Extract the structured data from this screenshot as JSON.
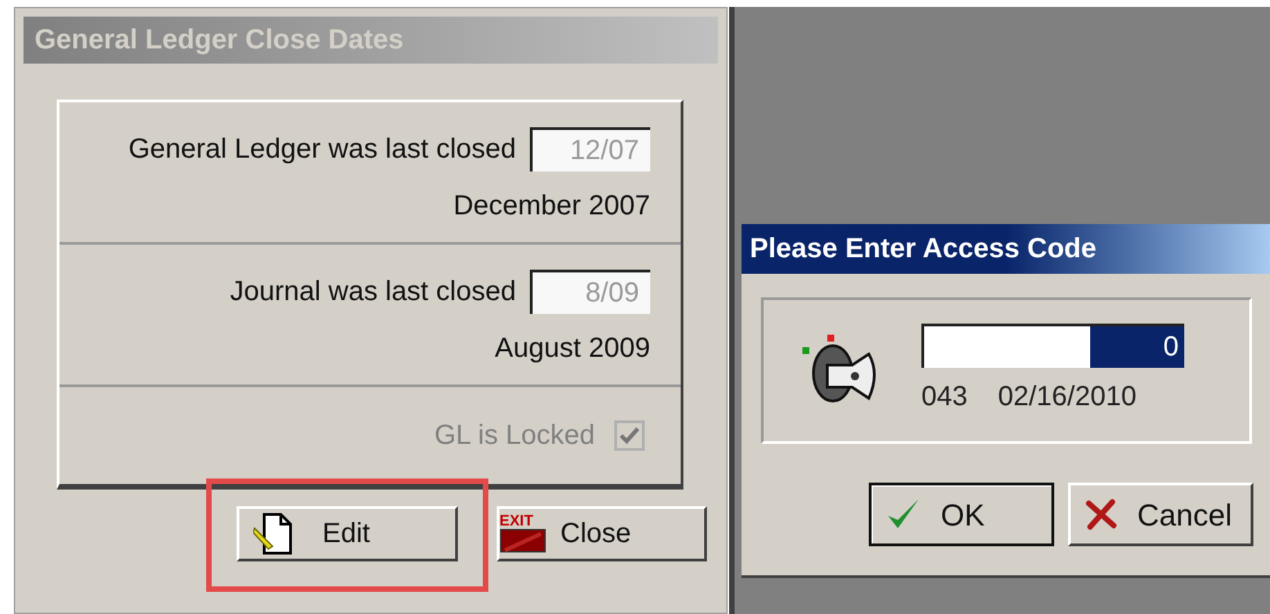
{
  "close_dates_window": {
    "title": "General Ledger Close Dates",
    "active": false,
    "sections": [
      {
        "label": "General Ledger was last closed",
        "field": {
          "value": "12/07",
          "disabled": true
        },
        "caption": "December 2007"
      },
      {
        "label": "Journal was last closed",
        "field": {
          "value": "8/09",
          "disabled": true
        },
        "caption": "August 2009"
      }
    ],
    "lock_checkbox": {
      "label": "GL is Locked",
      "checked": true,
      "disabled": true
    },
    "buttons": [
      {
        "kind": "edit",
        "label": "Edit",
        "highlighted": true
      },
      {
        "kind": "close",
        "label": "Close",
        "badge": "EXIT",
        "highlighted": false
      }
    ]
  },
  "access_code_window": {
    "title": "Please Enter Access Code",
    "active": true,
    "code_field": {
      "value": "0",
      "selected": true
    },
    "user_code": "043",
    "date": "02/16/2010",
    "buttons": [
      {
        "kind": "ok",
        "label": "OK",
        "default": true
      },
      {
        "kind": "cancel",
        "label": "Cancel",
        "default": false
      }
    ]
  }
}
